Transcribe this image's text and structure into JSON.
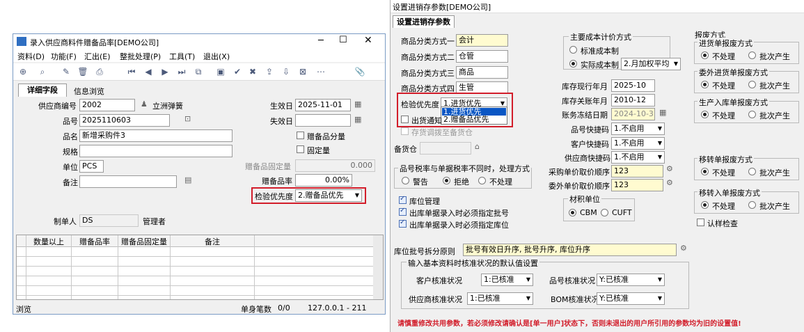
{
  "left": {
    "title": "录入供应商料件赠备品率[DEMO公司]",
    "menu": [
      "资料(D)",
      "功能(F)",
      "汇出(E)",
      "整批处理(P)",
      "工具(T)",
      "退出(X)"
    ],
    "tabs": [
      "详细字段",
      "信息浏览"
    ],
    "fields": {
      "supplier_label": "供应商编号",
      "supplier_value": "2002",
      "supplier_name": "立洲弹簧",
      "item_label": "品号",
      "item_value": "2025110603",
      "name_label": "品名",
      "name_value": "新增采购件3",
      "spec_label": "规格",
      "spec_value": "",
      "unit_label": "单位",
      "unit_value": "PCS",
      "remark_label": "备注",
      "remark_value": "",
      "effective_label": "生效日",
      "effective_value": "2025-11-01",
      "expire_label": "失效日",
      "expire_value": "",
      "spare_qty_label": "赠备品分量",
      "fixed_qty_label": "固定量",
      "spare_fixed_label": "赠备品固定量",
      "spare_fixed_value": "0.000",
      "spare_rate_label": "赠备品率",
      "spare_rate_value": "0.00%",
      "inspect_label": "检验优先度",
      "inspect_value": "2.赠备品优先",
      "creator_label": "制单人",
      "creator_value": "DS",
      "creator_name": "管理者"
    },
    "grid_headers": [
      "数量以上",
      "赠备品率",
      "赠备品固定量",
      "备注"
    ],
    "status": {
      "mode": "浏览",
      "count_label": "单身笔数",
      "count_value": "0/0",
      "server": "127.0.0.1 - 211"
    }
  },
  "right": {
    "title": "设置进销存参数[DEMO公司]",
    "tab": "设置进销存参数",
    "cat": [
      {
        "label": "商品分类方式一",
        "value": "会计"
      },
      {
        "label": "商品分类方式二",
        "value": "仓管"
      },
      {
        "label": "商品分类方式三",
        "value": "商品"
      },
      {
        "label": "商品分类方式四",
        "value": "生管"
      }
    ],
    "inspect_label": "检验优先度",
    "inspect_value": "1.进货优先",
    "inspect_options": [
      "1.进货优先",
      "2.赠备品优先"
    ],
    "ship_notice": "出货通知",
    "stock_chk": "存货调拨至备货仓",
    "reserve_wh": "备货仓",
    "cost": {
      "title": "主要成本计价方式",
      "std": "标准成本制",
      "act": "实际成本制",
      "method": "2.月加权平均"
    },
    "dates": {
      "cur_label": "库存现行年月",
      "cur_value": "2025-10",
      "close_label": "库存关账年月",
      "close_value": "2010-12",
      "freeze_label": "账务冻结日期",
      "freeze_value": "2024-10-31"
    },
    "quick": [
      {
        "label": "品号快捷码",
        "value": "1.不启用"
      },
      {
        "label": "客户快捷码",
        "value": "1.不启用"
      },
      {
        "label": "供应商快捷码",
        "value": "1.不启用"
      }
    ],
    "tax": {
      "title": "品号税率与单据税率不同时，处理方式",
      "warn": "警告",
      "reject": "拒绝",
      "none": "不处理"
    },
    "price": [
      {
        "label": "采购单价取价顺序",
        "value": "123"
      },
      {
        "label": "委外单价取价顺序",
        "value": "123"
      }
    ],
    "loc_mgmt": "库位管理",
    "out_batch": "出库单据录入时必须指定批号",
    "out_loc": "出库单据录入时必须指定库位",
    "material": {
      "title": "材积单位",
      "cbm": "CBM",
      "cuft": "CUFT"
    },
    "split_label": "库位批号拆分原则",
    "split_value": "批号有效日升序, 批号升序, 库位升序",
    "defaults": {
      "title": "输入基本资料时核准状况的默认值设置",
      "cust_label": "客户核准状况",
      "cust_value": "1:已核准",
      "item_label": "品号核准状况",
      "item_value": "Y:已核准",
      "sup_label": "供应商核准状况",
      "sup_value": "1:已核准",
      "bom_label": "BOM核准状况",
      "bom_value": "Y:已核准"
    },
    "scrap_title": "报废方式",
    "scrap": [
      {
        "title": "进货单报废方式"
      },
      {
        "title": "委外进货单报废方式"
      },
      {
        "title": "生产入库单报废方式"
      },
      {
        "title": "移转单报废方式"
      },
      {
        "title": "移转入单报废方式"
      }
    ],
    "no_process": "不处理",
    "batch_gen": "批次产生",
    "cert_check": "认样检查",
    "warning": "请慎重修改共用参数，若必须修改请确认是[单一用户]状态下，否则未退出的用户所引用的参数均为旧的设置值!"
  },
  "colors": {
    "red": "#d21d2a",
    "yellow": "#fffbd0",
    "select": "#0a56c4"
  }
}
